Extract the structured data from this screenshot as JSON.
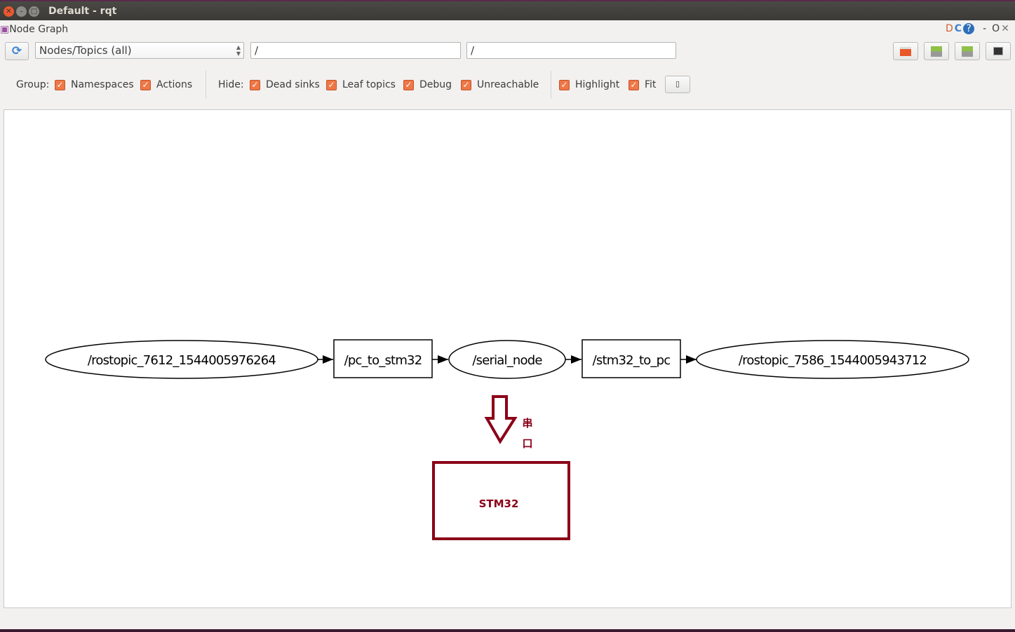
{
  "window": {
    "title": "Default - rqt"
  },
  "plugin": {
    "title": "Node Graph",
    "corner": [
      "D",
      "C",
      "?",
      "-",
      "O",
      "✕"
    ]
  },
  "toolbar": {
    "graph_type": "Nodes/Topics (all)",
    "ns_filter": "/",
    "topic_filter": "/"
  },
  "group": {
    "label": "Group:",
    "items": [
      {
        "label": "Namespaces",
        "checked": true
      },
      {
        "label": "Actions",
        "checked": true
      }
    ]
  },
  "hide": {
    "label": "Hide:",
    "items": [
      {
        "label": "Dead sinks",
        "checked": true
      },
      {
        "label": "Leaf topics",
        "checked": true
      },
      {
        "label": "Debug",
        "checked": true
      },
      {
        "label": "Unreachable",
        "checked": true
      }
    ]
  },
  "view": {
    "items": [
      {
        "label": "Highlight",
        "checked": true
      },
      {
        "label": "Fit",
        "checked": true
      }
    ]
  },
  "graph": {
    "nodes": [
      "/rostopic_7612_1544005976264",
      "/pc_to_stm32",
      "/serial_node",
      "/stm32_to_pc",
      "/rostopic_7586_1544005943712"
    ],
    "annotation": {
      "label1": "串",
      "label2": "口",
      "box": "STM32",
      "color": "#8b0018"
    }
  }
}
